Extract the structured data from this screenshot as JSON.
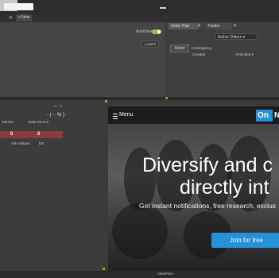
{
  "top": {
    "new_label": "+ New",
    "tab_close": "✕"
  },
  "layout_panel": {
    "autosave_label": "AutoSave",
    "autosave_on": true,
    "load_label": "Load ▾"
  },
  "orders": {
    "tabs": [
      {
        "label": "Order Pad",
        "close": "✕"
      },
      {
        "label": "Trades",
        "close": "✕"
      }
    ],
    "filter_label": "Active Orders ▾",
    "subtabs": [
      "Order",
      "Contingency"
    ],
    "columns": [
      "Created",
      "Amended ▾"
    ]
  },
  "quote": {
    "dashes": "– –",
    "change": "- ( -- % )",
    "labels": [
      "Volume",
      "Data Source"
    ],
    "bid_value": "0",
    "ask_value": "0",
    "labels2": [
      "Ask Volume",
      "DS"
    ]
  },
  "website": {
    "menu_label": "Menu",
    "logo_text": "On",
    "logo_tail": "N",
    "headline_1": "Diversify and c",
    "headline_2": "directly int",
    "subline": "Get instant notifications, free research, exclus",
    "cta_label": "Join for free"
  },
  "footer": {
    "viewport_label": "ViewPoint"
  },
  "colors": {
    "accent": "#2491d8",
    "toggle_on": "#8cc63e",
    "sell": "#8a3b3b",
    "highlight": "#e08a1e"
  }
}
